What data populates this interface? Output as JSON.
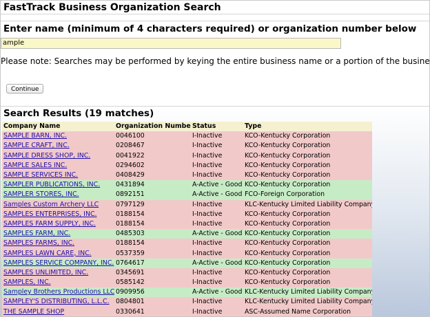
{
  "page": {
    "title": "FastTrack Business Organization Search",
    "entry_heading": "Enter name (minimum of 4 characters required) or organization number below",
    "search_value": "ample",
    "note": "Please note: Searches may be performed by keying the entire business name or a portion of the business name.",
    "continue_label": "Continue",
    "results_heading": "Search Results (19 matches)"
  },
  "table": {
    "columns": [
      "Company Name",
      "Organization Number",
      "Status",
      "Type"
    ],
    "rows": [
      {
        "name": "SAMPLE BARN, INC.",
        "number": "0046100",
        "status": "I-Inactive",
        "type": "KCO-Kentucky Corporation",
        "state": "inactive"
      },
      {
        "name": "SAMPLE CRAFT, INC.",
        "number": "0208467",
        "status": "I-Inactive",
        "type": "KCO-Kentucky Corporation",
        "state": "inactive"
      },
      {
        "name": "SAMPLE DRESS SHOP, INC.",
        "number": "0041922",
        "status": "I-Inactive",
        "type": "KCO-Kentucky Corporation",
        "state": "inactive"
      },
      {
        "name": "SAMPLE SALES INC.",
        "number": "0294602",
        "status": "I-Inactive",
        "type": "KCO-Kentucky Corporation",
        "state": "inactive"
      },
      {
        "name": "SAMPLE SERVICES INC.",
        "number": "0408429",
        "status": "I-Inactive",
        "type": "KCO-Kentucky Corporation",
        "state": "inactive"
      },
      {
        "name": "SAMPLER PUBLICATIONS, INC.",
        "number": "0431894",
        "status": "A-Active - Good",
        "type": "KCO-Kentucky Corporation",
        "state": "active"
      },
      {
        "name": "SAMPLER STORES, INC.",
        "number": "0892151",
        "status": "A-Active - Good",
        "type": "FCO-Foreign Corporation",
        "state": "active"
      },
      {
        "name": "Samples Custom Archery LLC",
        "number": "0797129",
        "status": "I-Inactive",
        "type": "KLC-Kentucky Limited Liability Company",
        "state": "inactive"
      },
      {
        "name": "SAMPLES ENTERPRISES, INC.",
        "number": "0188154",
        "status": "I-Inactive",
        "type": "KCO-Kentucky Corporation",
        "state": "inactive"
      },
      {
        "name": "SAMPLES FARM SUPPLY, INC.",
        "number": "0188154",
        "status": "I-Inactive",
        "type": "KCO-Kentucky Corporation",
        "state": "inactive"
      },
      {
        "name": "SAMPLES FARM, INC.",
        "number": "0485303",
        "status": "A-Active - Good",
        "type": "KCO-Kentucky Corporation",
        "state": "active"
      },
      {
        "name": "SAMPLES FARMS, INC.",
        "number": "0188154",
        "status": "I-Inactive",
        "type": "KCO-Kentucky Corporation",
        "state": "inactive"
      },
      {
        "name": "SAMPLES LAWN CARE, INC.",
        "number": "0537359",
        "status": "I-Inactive",
        "type": "KCO-Kentucky Corporation",
        "state": "inactive"
      },
      {
        "name": "SAMPLES SERVICE COMPANY, INC.",
        "number": "0764617",
        "status": "A-Active - Good",
        "type": "KCO-Kentucky Corporation",
        "state": "active"
      },
      {
        "name": "SAMPLES UNLIMITED, INC.",
        "number": "0345691",
        "status": "I-Inactive",
        "type": "KCO-Kentucky Corporation",
        "state": "inactive"
      },
      {
        "name": "SAMPLES, INC.",
        "number": "0585142",
        "status": "I-Inactive",
        "type": "KCO-Kentucky Corporation",
        "state": "inactive"
      },
      {
        "name": "Sampley Brothers Productions LLC",
        "number": "0909956",
        "status": "A-Active - Good",
        "type": "KLC-Kentucky Limited Liability Company",
        "state": "active"
      },
      {
        "name": "SAMPLEY'S DISTRIBUTING, L.L.C.",
        "number": "0804801",
        "status": "I-Inactive",
        "type": "KLC-Kentucky Limited Liability Company",
        "state": "inactive"
      },
      {
        "name": "THE SAMPLE SHOP",
        "number": "0330641",
        "status": "I-Inactive",
        "type": "ASC-Assumed Name Corporation",
        "state": "inactive"
      }
    ]
  },
  "colors": {
    "inactive_row": "#f2c9c9",
    "active_row": "#c6ecc6",
    "header_row": "#f4f0d0",
    "input_bg": "#fbf8c8",
    "link": "#1a0dab"
  }
}
